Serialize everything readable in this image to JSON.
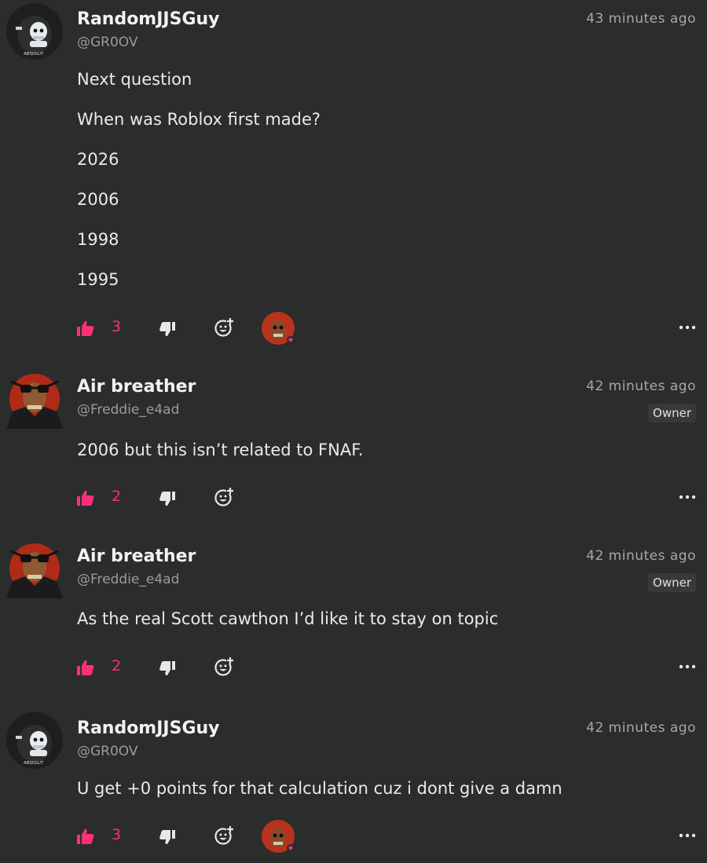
{
  "colors": {
    "background": "#2a2d2b",
    "like_accent": "#ff2f7a",
    "muted_text": "#9a9c9a",
    "badge_bg": "#373a38"
  },
  "posts": [
    {
      "author": "RandomJJSGuy",
      "handle": "@GR0OV",
      "time": "43 minutes ago",
      "avatar_text": "ABSOLUT",
      "lines": [
        "Next question",
        "When was Roblox first made?",
        "2026",
        "2006",
        "1998",
        "1995"
      ],
      "likes": "3"
    },
    {
      "author": "Air breather",
      "handle": "@Freddie_e4ad",
      "time": "42 minutes ago",
      "badge": "Owner",
      "lines": [
        "2006 but this isn’t related to FNAF."
      ],
      "likes": "2"
    },
    {
      "author": "Air breather",
      "handle": "@Freddie_e4ad",
      "time": "42 minutes ago",
      "badge": "Owner",
      "lines": [
        "As the real Scott cawthon I’d like it to stay on topic"
      ],
      "likes": "2"
    },
    {
      "author": "RandomJJSGuy",
      "handle": "@GR0OV",
      "time": "42 minutes ago",
      "avatar_text": "ABSOLUT",
      "lines": [
        "U get +0 points for that calculation cuz i dont give a damn"
      ],
      "likes": "3"
    }
  ]
}
